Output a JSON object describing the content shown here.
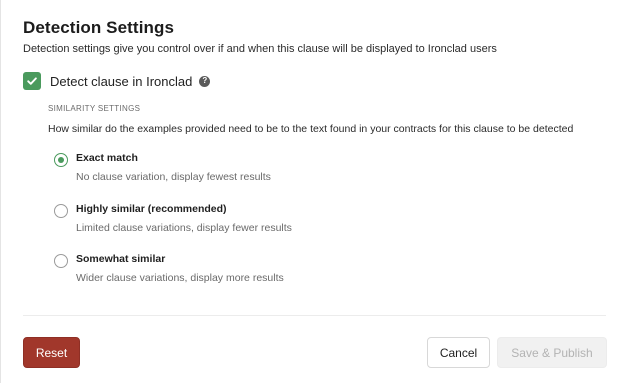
{
  "header": {
    "title": "Detection Settings",
    "subtitle": "Detection settings give you control over if and when this clause will be displayed to Ironclad users"
  },
  "detect": {
    "label": "Detect clause in Ironclad",
    "checked": true,
    "help_icon": "question-icon",
    "help_glyph": "?"
  },
  "similarity": {
    "heading": "SIMILARITY SETTINGS",
    "description": "How similar do the examples provided need to be to the text found in your contracts for this clause to be detected",
    "options": [
      {
        "label": "Exact match",
        "description": "No clause variation, display fewest results",
        "selected": true
      },
      {
        "label": "Highly similar (recommended)",
        "description": "Limited clause variations, display fewer results",
        "selected": false
      },
      {
        "label": "Somewhat similar",
        "description": "Wider clause variations, display more results",
        "selected": false
      }
    ]
  },
  "footer": {
    "reset_label": "Reset",
    "cancel_label": "Cancel",
    "save_label": "Save & Publish"
  },
  "colors": {
    "accent_green": "#4a9a5d",
    "reset_red": "#a1372b"
  }
}
